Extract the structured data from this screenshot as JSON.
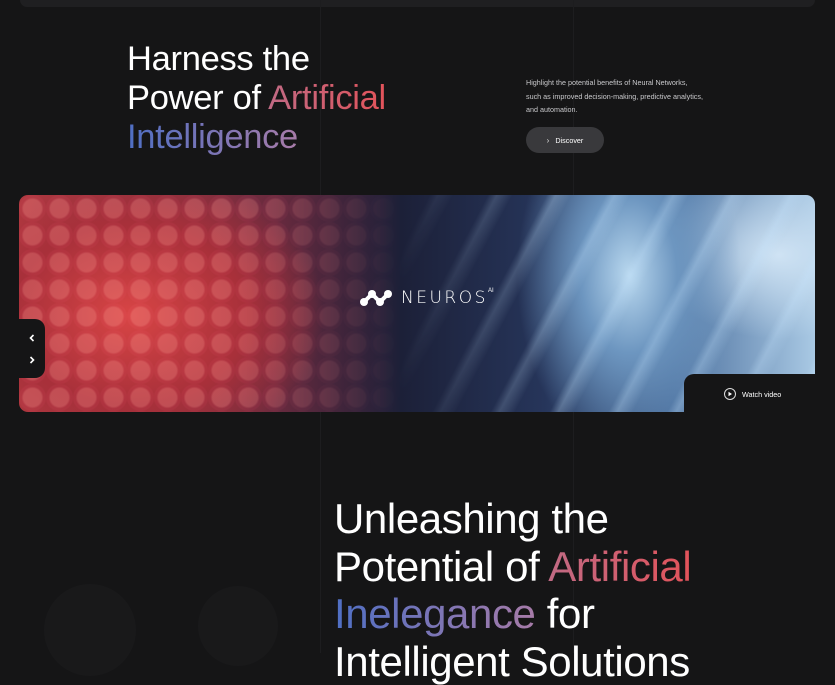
{
  "hero": {
    "line1": "Harness the",
    "line2_plain": "Power of ",
    "line2_accent": "Artificial",
    "line3_accent": "Intelligence"
  },
  "intro": {
    "description_lines": [
      "Highlight the potential benefits of Neural Networks,",
      "such as improved decision-making, predictive analytics,",
      "and automation."
    ],
    "discover_label": "Discover"
  },
  "banner": {
    "brand_name": "NEUROS",
    "brand_suffix": "AI",
    "watch_label": "Watch video"
  },
  "headline": {
    "line1": "Unleashing the",
    "line2_plain": "Potential of ",
    "line2_accent": "Artificial",
    "line3_accent": "Inelegance",
    "line3_plain": " for",
    "line4": "Intelligent Solutions"
  },
  "icons": {
    "discover": "chevron-right-icon",
    "prev": "chevron-left-icon",
    "next": "chevron-right-icon",
    "watch": "play-icon",
    "logo": "neuros-logo-mark"
  },
  "colors": {
    "background": "#151516",
    "accent_red": "#e2535a",
    "accent_blue": "#4f6fc4",
    "button": "#39393c"
  }
}
